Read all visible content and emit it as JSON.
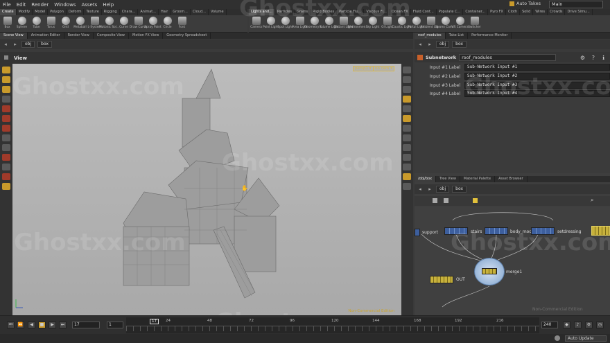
{
  "menu": [
    "File",
    "Edit",
    "Render",
    "Windows",
    "Assets",
    "Help"
  ],
  "auto_takes": "Auto Takes",
  "desktop": "Main",
  "shelf_left": {
    "tabs": [
      "Create",
      "Modify",
      "Model",
      "Polygon",
      "Deform",
      "Texture",
      "Rigging",
      "Chara...",
      "Animat...",
      "Hair",
      "Groom...",
      "Cloud...",
      "Volume"
    ],
    "tools": [
      "Box",
      "Sphere",
      "Tube",
      "Torus",
      "Grid",
      "Metaball",
      "L-System",
      "Platonic Sol...",
      "Curve",
      "Draw Curve",
      "Spray Paint",
      "Circle",
      "Font"
    ]
  },
  "shelf_right": {
    "tabs": [
      "Lights and...",
      "Particles",
      "Grains",
      "Rigid Bodies",
      "Particle Flu...",
      "Viscous Fl...",
      "Ocean FX",
      "Fluid Cont...",
      "Populate C...",
      "Container...",
      "Pyro FX",
      "Cloth",
      "Solid",
      "Wires",
      "Crowds",
      "Drive Simu..."
    ],
    "tools": [
      "Camera",
      "Point Light",
      "Spot Light",
      "Area Light",
      "Geometry L...",
      "Volume Light",
      "Distant Light",
      "Environmen...",
      "Sky Light",
      "GI Light",
      "Caustic Light",
      "Portal Light",
      "Ambient Lig...",
      "Stereo Cam...",
      "VR Camera",
      "Switcher"
    ]
  },
  "pane_tabs_left": [
    "Scene View",
    "Animation Editor",
    "Render View",
    "Composite View",
    "Motion FX View",
    "Geometry Spreadsheet"
  ],
  "pane_tabs_params": [
    "roof_modules",
    "Take List",
    "Performance Monitor"
  ],
  "pane_tabs_network": [
    "/obj/box",
    "Tree View",
    "Material Palette",
    "Asset Browser"
  ],
  "path": {
    "obj": "obj",
    "node": "box"
  },
  "view": {
    "title": "View",
    "persp": "persp1 ▾",
    "cam": "no cam ▾",
    "nce": "Non-Commercial Edition"
  },
  "params": {
    "type": "Subnetwork",
    "name": "roof_modules",
    "rows": [
      {
        "label": "Input #1 Label",
        "value": "Sub-Network Input #1"
      },
      {
        "label": "Input #2 Label",
        "value": "Sub-Network Input #2"
      },
      {
        "label": "Input #3 Label",
        "value": "Sub-Network Input #3"
      },
      {
        "label": "Input #4 Label",
        "value": "Sub-Network Input #4"
      }
    ]
  },
  "network": {
    "nodes": [
      "support",
      "stairs",
      "body_mod",
      "setdressing",
      "merge1",
      "OUT"
    ],
    "nce": "Non-Commercial Edition"
  },
  "timeline": {
    "current_frame": "17",
    "start_frame": "1",
    "end_frame": "240",
    "ticks": [
      "24",
      "48",
      "72",
      "96",
      "120",
      "144",
      "168",
      "192",
      "216"
    ],
    "marker": "17",
    "marker_end": "240"
  },
  "status": {
    "auto_update": "Auto Update"
  },
  "watermark": "Ghostxx.com",
  "colors": {
    "accent": "#c99a2b",
    "node_blue": "#3d5f9e",
    "node_yellow": "#c8b23c"
  }
}
